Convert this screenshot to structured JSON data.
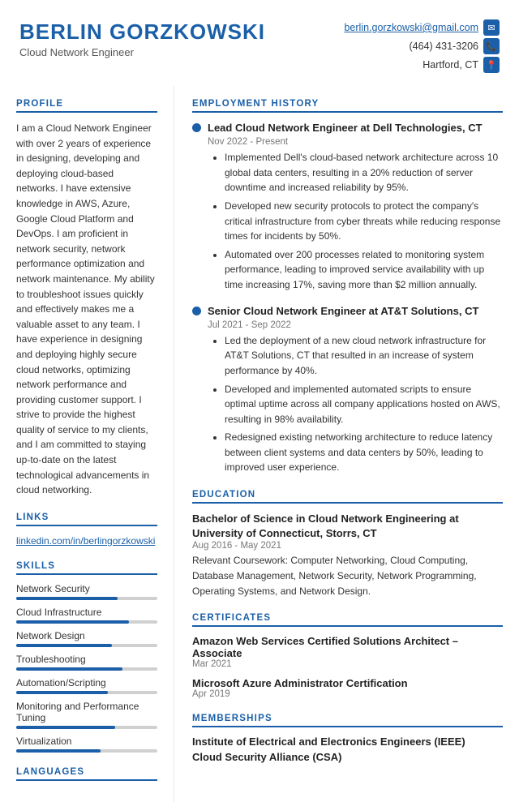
{
  "header": {
    "name": "BERLIN GORZKOWSKI",
    "title": "Cloud Network Engineer",
    "email": "berlin.gorzkowski@gmail.com",
    "phone": "(464) 431-3206",
    "location": "Hartford, CT"
  },
  "sidebar": {
    "profile_title": "PROFILE",
    "profile_text": "I am a Cloud Network Engineer with over 2 years of experience in designing, developing and deploying cloud-based networks. I have extensive knowledge in AWS, Azure, Google Cloud Platform and DevOps. I am proficient in network security, network performance optimization and network maintenance. My ability to troubleshoot issues quickly and effectively makes me a valuable asset to any team. I have experience in designing and deploying highly secure cloud networks, optimizing network performance and providing customer support. I strive to provide the highest quality of service to my clients, and I am committed to staying up-to-date on the latest technological advancements in cloud networking.",
    "links_title": "LINKS",
    "linkedin": "linkedin.com/in/berlingorzkowski",
    "skills_title": "SKILLS",
    "skills": [
      {
        "name": "Network Security",
        "pct": 72
      },
      {
        "name": "Cloud Infrastructure",
        "pct": 80
      },
      {
        "name": "Network Design",
        "pct": 68
      },
      {
        "name": "Troubleshooting",
        "pct": 75
      },
      {
        "name": "Automation/Scripting",
        "pct": 65
      },
      {
        "name": "Monitoring and Performance Tuning",
        "pct": 70
      },
      {
        "name": "Virtualization",
        "pct": 60
      }
    ],
    "languages_title": "LANGUAGES"
  },
  "content": {
    "employment_title": "EMPLOYMENT HISTORY",
    "jobs": [
      {
        "title": "Lead Cloud Network Engineer at Dell Technologies, CT",
        "date": "Nov 2022 - Present",
        "bullets": [
          "Implemented Dell's cloud-based network architecture across 10 global data centers, resulting in a 20% reduction of server downtime and increased reliability by 95%.",
          "Developed new security protocols to protect the company's critical infrastructure from cyber threats while reducing response times for incidents by 50%.",
          "Automated over 200 processes related to monitoring system performance, leading to improved service availability with up time increasing 17%, saving more than $2 million annually."
        ]
      },
      {
        "title": "Senior Cloud Network Engineer at AT&T Solutions, CT",
        "date": "Jul 2021 - Sep 2022",
        "bullets": [
          "Led the deployment of a new cloud network infrastructure for AT&T Solutions, CT that resulted in an increase of system performance by 40%.",
          "Developed and implemented automated scripts to ensure optimal uptime across all company applications hosted on AWS, resulting in 98% availability.",
          "Redesigned existing networking architecture to reduce latency between client systems and data centers by 50%, leading to improved user experience."
        ]
      }
    ],
    "education_title": "EDUCATION",
    "education": [
      {
        "title": "Bachelor of Science in Cloud Network Engineering at University of Connecticut, Storrs, CT",
        "date": "Aug 2016 - May 2021",
        "detail": "Relevant Coursework: Computer Networking, Cloud Computing, Database Management, Network Security, Network Programming, Operating Systems, and Network Design."
      }
    ],
    "certificates_title": "CERTIFICATES",
    "certificates": [
      {
        "title": "Amazon Web Services Certified Solutions Architect – Associate",
        "date": "Mar 2021"
      },
      {
        "title": "Microsoft Azure Administrator Certification",
        "date": "Apr 2019"
      }
    ],
    "memberships_title": "MEMBERSHIPS",
    "memberships": [
      "Institute of Electrical and Electronics Engineers (IEEE)",
      "Cloud Security Alliance (CSA)"
    ]
  }
}
